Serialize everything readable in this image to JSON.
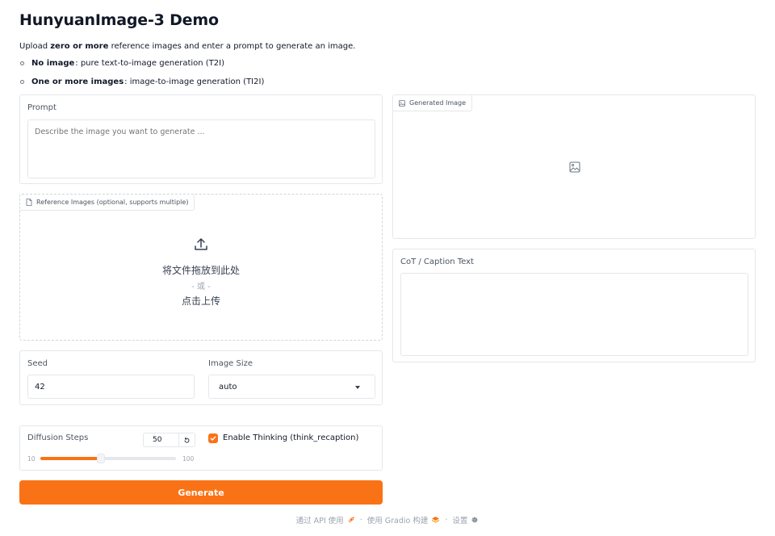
{
  "header": {
    "title": "HunyuanImage-3 Demo",
    "intro_prefix": "Upload ",
    "intro_bold": "zero or more",
    "intro_suffix": " reference images and enter a prompt to generate an image.",
    "bullets": [
      {
        "bold": "No image",
        "text": ": pure text-to-image generation (T2I)"
      },
      {
        "bold": "One or more images",
        "text": ": image-to-image generation (TI2I)"
      }
    ]
  },
  "prompt": {
    "label": "Prompt",
    "placeholder": "Describe the image you want to generate ...",
    "value": ""
  },
  "reference": {
    "label": "Reference Images (optional, supports multiple)",
    "drop_text": "将文件拖放到此处",
    "or_text": "- 或 -",
    "click_text": "点击上传"
  },
  "seed": {
    "label": "Seed",
    "value": "42"
  },
  "image_size": {
    "label": "Image Size",
    "selected": "auto"
  },
  "diffusion": {
    "label": "Diffusion Steps",
    "value": "50",
    "min": "10",
    "max": "100",
    "fraction": 0.4444
  },
  "thinking": {
    "label": "Enable Thinking (think_recaption)",
    "checked": true
  },
  "generate_button": "Generate",
  "output": {
    "image_label": "Generated Image",
    "cot_label": "CoT / Caption Text",
    "cot_value": ""
  },
  "footer": {
    "api": "通过 API 使用",
    "dot1": "·",
    "built": "使用 Gradio 构建",
    "dot2": "·",
    "settings": "设置"
  },
  "colors": {
    "accent": "#f97316",
    "border": "#e5e7eb",
    "text": "#111827"
  },
  "icons": [
    "file-icon",
    "upload-icon",
    "image-icon",
    "image-placeholder-icon",
    "reset-icon",
    "check-icon",
    "rocket-icon",
    "gradio-logo-icon",
    "gear-icon"
  ]
}
